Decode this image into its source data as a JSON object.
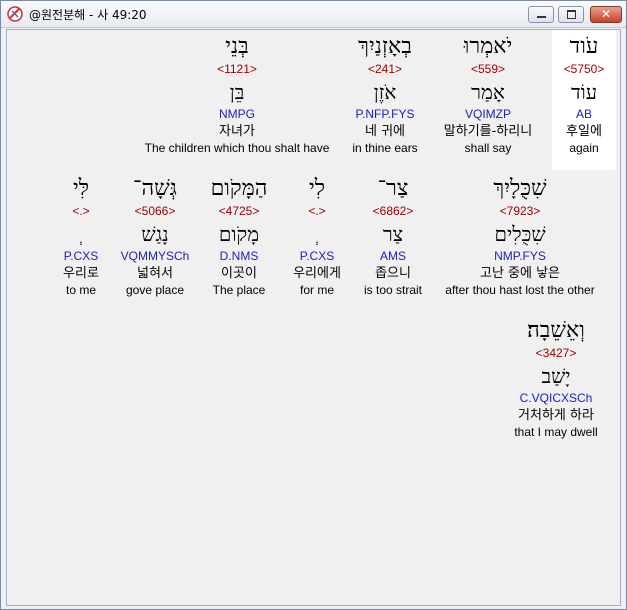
{
  "window": {
    "title": "@원전분해 - 사 49:20"
  },
  "words": [
    {
      "heb": "עֹוד",
      "strong": "<5750>",
      "lemma": "עוֹד",
      "morph": "AB",
      "korean": "후일에",
      "english": "again"
    },
    {
      "heb": "יֹאמְרוּ",
      "strong": "<559>",
      "lemma": "אָמַר",
      "morph": "VQIMZP",
      "korean": "말하기를-하리니",
      "english": "shall say"
    },
    {
      "heb": "בְאָזְנַיִךְ",
      "strong": "<241>",
      "lemma": "אֹזֶן",
      "morph": "P.NFP.FYS",
      "korean": "네 귀에",
      "english": "in thine ears"
    },
    {
      "heb": "בְּנֵי",
      "strong": "<1121>",
      "lemma": "בֵּן",
      "morph": "NMPG",
      "korean": "자녀가",
      "english": "The children which thou shalt have"
    },
    {
      "heb": "שִׁכֻּלָיִךְ",
      "strong": "<7923>",
      "lemma": "שִׁכֻּלִים",
      "morph": "NMP.FYS",
      "korean": "고난 중에 낳은",
      "english": "after thou hast lost the other"
    },
    {
      "heb": "צַר־",
      "strong": "<6862>",
      "lemma": "צַר",
      "morph": "AMS",
      "korean": "좁으니",
      "english": "is too strait"
    },
    {
      "heb": "לִי",
      "strong": "<.>",
      "lemma": "ְ",
      "morph": "P.CXS",
      "korean": "우리에게",
      "english": "for me"
    },
    {
      "heb": "הַמָּקֹום",
      "strong": "<4725>",
      "lemma": "מָקֹום",
      "morph": "D.NMS",
      "korean": "이곳이",
      "english": "The place"
    },
    {
      "heb": "גְּשָׁה־",
      "strong": "<5066>",
      "lemma": "נָגַשׁ",
      "morph": "VQMMYSCh",
      "korean": "넓혀서",
      "english": "gove place"
    },
    {
      "heb": "לִּי",
      "strong": "<.>",
      "lemma": "ְ",
      "morph": "P.CXS",
      "korean": "우리로",
      "english": "to me"
    },
    {
      "heb": "וְאֵשֵׁבָה׃",
      "strong": "<3427>",
      "lemma": "יָשַׁב",
      "morph": "C.VQICXSCh",
      "korean": "거처하게 하라",
      "english": "that I may dwell"
    }
  ]
}
